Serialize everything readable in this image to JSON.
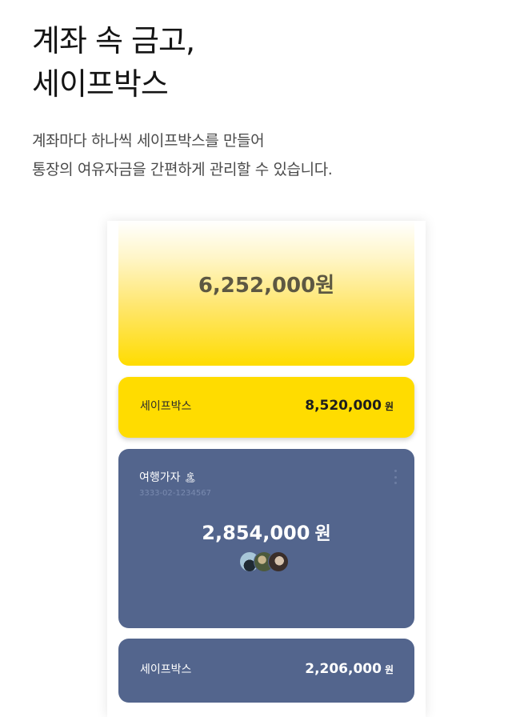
{
  "headline": {
    "line1": "계좌 속 금고,",
    "line2": "세이프박스"
  },
  "description": {
    "line1": "계좌마다 하나씩 세이프박스를 만들어",
    "line2": "통장의 여유자금을 간편하게 관리할 수 있습니다."
  },
  "phone": {
    "total_card": {
      "amount": "6,252,000원"
    },
    "safebox_yellow": {
      "label": "세이프박스",
      "amount": "8,520,000",
      "unit": "원"
    },
    "travel_account": {
      "name": "여행가자",
      "emoji": "🏝",
      "account_number": "3333-02-1234567",
      "amount": "2,854,000",
      "unit": "원",
      "avatars": [
        "avatar-1",
        "avatar-2",
        "avatar-3"
      ],
      "more_icon": "more-vertical-icon"
    },
    "safebox_blue": {
      "label": "세이프박스",
      "amount": "2,206,000",
      "unit": "원"
    }
  },
  "colors": {
    "yellow": "#ffdc00",
    "navy": "#53658d"
  }
}
